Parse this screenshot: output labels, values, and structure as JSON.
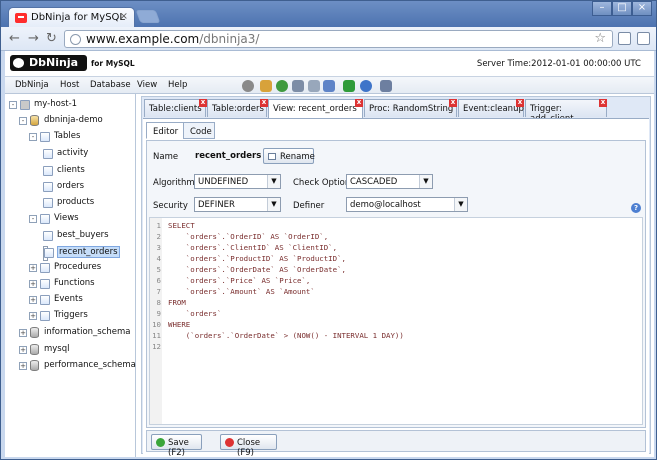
{
  "browser": {
    "tab_title": "DbNinja for MySQL",
    "tab_close": "×",
    "window_buttons": [
      "–",
      "□",
      "×"
    ],
    "url_host": "www.example.com",
    "url_path": "/dbninja3/"
  },
  "app": {
    "logo_text": "DbNinja",
    "logo_sub": "for MySQL",
    "server_time": "Server Time:2012-01-01 00:00:00 UTC",
    "menu": [
      "DbNinja",
      "Host",
      "Database",
      "View",
      "Help"
    ]
  },
  "tree": {
    "host": "my-host-1",
    "db": "dbninja-demo",
    "tables_label": "Tables",
    "tables": [
      "activity",
      "clients",
      "orders",
      "products"
    ],
    "views_label": "Views",
    "views": [
      "best_buyers",
      "recent_orders"
    ],
    "procedures_label": "Procedures",
    "functions_label": "Functions",
    "events_label": "Events",
    "triggers_label": "Triggers",
    "other_dbs": [
      "information_schema",
      "mysql",
      "performance_schema"
    ]
  },
  "doc_tabs": [
    "Table:clients",
    "Table:orders",
    "View: recent_orders",
    "Proc: RandomString",
    "Event:cleanup",
    "Trigger: add_client"
  ],
  "sub_tabs": [
    "Editor",
    "Code"
  ],
  "form": {
    "name_label": "Name",
    "name_value": "recent_orders",
    "rename_button": "Rename",
    "algorithm_label": "Algorithm",
    "algorithm_value": "UNDEFINED",
    "check_label": "Check Option",
    "check_value": "CASCADED",
    "security_label": "Security",
    "security_value": "DEFINER",
    "definer_label": "Definer",
    "definer_value": "demo@localhost"
  },
  "code_lines": [
    "SELECT",
    "    `orders`.`OrderID` AS `OrderID`,",
    "    `orders`.`ClientID` AS `ClientID`,",
    "    `orders`.`ProductID` AS `ProductID`,",
    "    `orders`.`OrderDate` AS `OrderDate`,",
    "    `orders`.`Price` AS `Price`,",
    "    `orders`.`Amount` AS `Amount`",
    "FROM",
    "    `orders`",
    "WHERE",
    "    (`orders`.`OrderDate` > (NOW() - INTERVAL 1 DAY))"
  ],
  "line_numbers": [
    "1",
    "2",
    "3",
    "4",
    "5",
    "6",
    "7",
    "8",
    "9",
    "10",
    "11",
    "12"
  ],
  "buttons": {
    "save": "Save (F2)",
    "close": "Close (F9)"
  }
}
